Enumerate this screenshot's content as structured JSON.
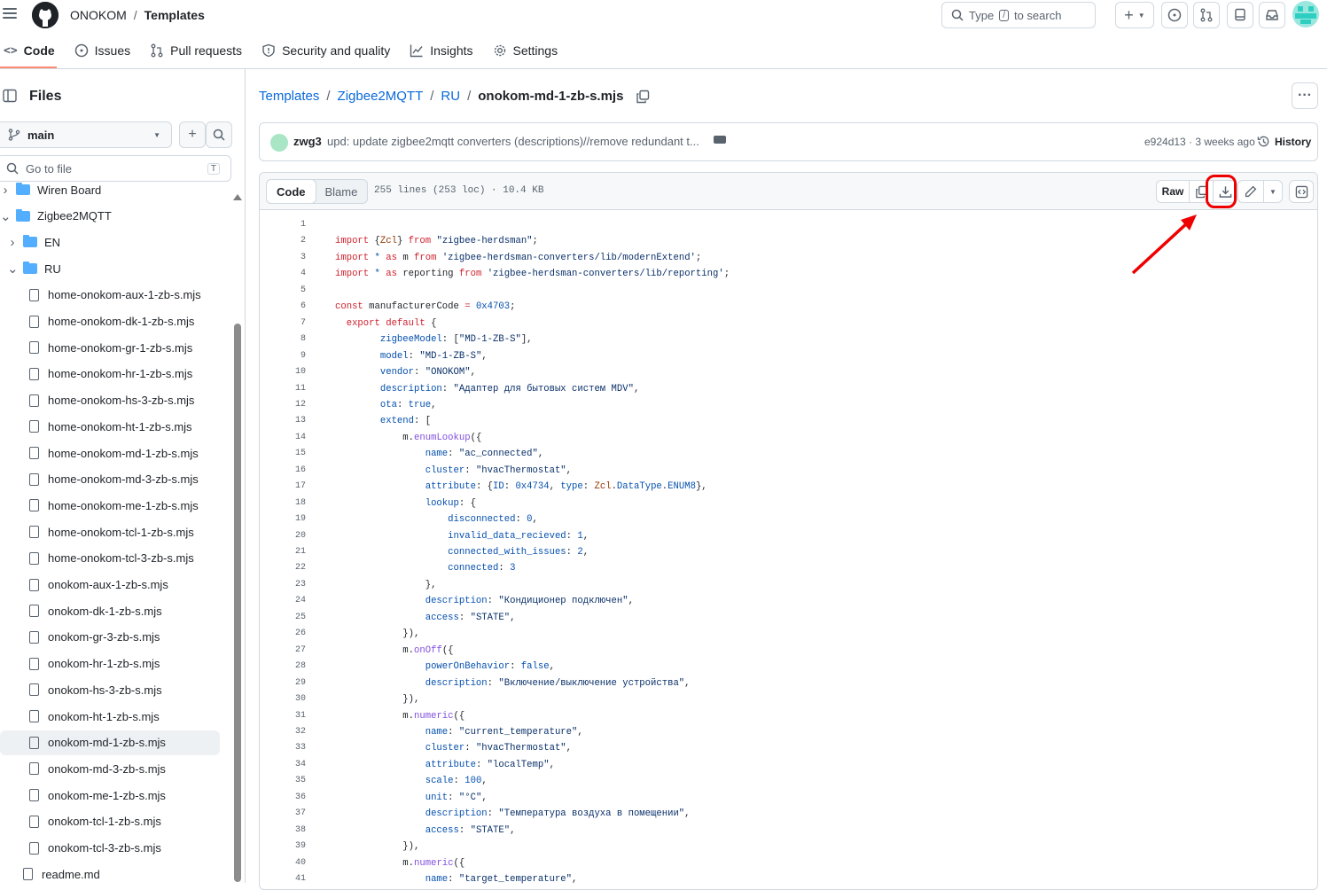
{
  "topbar": {
    "owner": "ONOKOM",
    "separator": "/",
    "repo": "Templates",
    "search_prefix": "Type",
    "search_key": "/",
    "search_suffix": "to search"
  },
  "repo_nav": {
    "tabs": [
      {
        "label": "Code"
      },
      {
        "label": "Issues"
      },
      {
        "label": "Pull requests"
      },
      {
        "label": "Security and quality"
      },
      {
        "label": "Insights"
      },
      {
        "label": "Settings"
      }
    ]
  },
  "sidebar": {
    "title": "Files",
    "branch": "main",
    "goto_placeholder": "Go to file",
    "goto_key": "T",
    "tree": [
      {
        "label": "Wiren Board",
        "type": "folder",
        "expanded": false,
        "depth": 0
      },
      {
        "label": "Zigbee2MQTT",
        "type": "folder",
        "expanded": true,
        "depth": 0
      },
      {
        "label": "EN",
        "type": "folder",
        "expanded": false,
        "depth": 1
      },
      {
        "label": "RU",
        "type": "folder",
        "expanded": true,
        "depth": 1
      },
      {
        "label": "home-onokom-aux-1-zb-s.mjs",
        "type": "file",
        "depth": 2
      },
      {
        "label": "home-onokom-dk-1-zb-s.mjs",
        "type": "file",
        "depth": 2
      },
      {
        "label": "home-onokom-gr-1-zb-s.mjs",
        "type": "file",
        "depth": 2
      },
      {
        "label": "home-onokom-hr-1-zb-s.mjs",
        "type": "file",
        "depth": 2
      },
      {
        "label": "home-onokom-hs-3-zb-s.mjs",
        "type": "file",
        "depth": 2
      },
      {
        "label": "home-onokom-ht-1-zb-s.mjs",
        "type": "file",
        "depth": 2
      },
      {
        "label": "home-onokom-md-1-zb-s.mjs",
        "type": "file",
        "depth": 2
      },
      {
        "label": "home-onokom-md-3-zb-s.mjs",
        "type": "file",
        "depth": 2
      },
      {
        "label": "home-onokom-me-1-zb-s.mjs",
        "type": "file",
        "depth": 2
      },
      {
        "label": "home-onokom-tcl-1-zb-s.mjs",
        "type": "file",
        "depth": 2
      },
      {
        "label": "home-onokom-tcl-3-zb-s.mjs",
        "type": "file",
        "depth": 2
      },
      {
        "label": "onokom-aux-1-zb-s.mjs",
        "type": "file",
        "depth": 2
      },
      {
        "label": "onokom-dk-1-zb-s.mjs",
        "type": "file",
        "depth": 2
      },
      {
        "label": "onokom-gr-3-zb-s.mjs",
        "type": "file",
        "depth": 2
      },
      {
        "label": "onokom-hr-1-zb-s.mjs",
        "type": "file",
        "depth": 2
      },
      {
        "label": "onokom-hs-3-zb-s.mjs",
        "type": "file",
        "depth": 2
      },
      {
        "label": "onokom-ht-1-zb-s.mjs",
        "type": "file",
        "depth": 2
      },
      {
        "label": "onokom-md-1-zb-s.mjs",
        "type": "file",
        "depth": 2,
        "selected": true
      },
      {
        "label": "onokom-md-3-zb-s.mjs",
        "type": "file",
        "depth": 2
      },
      {
        "label": "onokom-me-1-zb-s.mjs",
        "type": "file",
        "depth": 2
      },
      {
        "label": "onokom-tcl-1-zb-s.mjs",
        "type": "file",
        "depth": 2
      },
      {
        "label": "onokom-tcl-3-zb-s.mjs",
        "type": "file",
        "depth": 2
      },
      {
        "label": "readme.md",
        "type": "file",
        "depth": 1
      }
    ]
  },
  "breadcrumb": {
    "parts": [
      "Templates",
      "Zigbee2MQTT",
      "RU"
    ],
    "current": "onokom-md-1-zb-s.mjs",
    "separator": "/"
  },
  "commit": {
    "author": "zwg3",
    "message": "upd: update zigbee2mqtt converters (descriptions)//remove redundant t...",
    "meta": "e924d13 · 3 weeks ago",
    "history_label": "History"
  },
  "file_header": {
    "code_tab": "Code",
    "blame_tab": "Blame",
    "meta": "255 lines (253 loc) · 10.4 KB",
    "raw_label": "Raw"
  },
  "code_lines": [
    [],
    [
      [
        "k",
        "import "
      ],
      [
        "",
        "{"
      ],
      [
        "c",
        "Zcl"
      ],
      [
        "",
        "} "
      ],
      [
        "k",
        "from "
      ],
      [
        "s",
        "\"zigbee-herdsman\""
      ],
      [
        "",
        ";"
      ]
    ],
    [
      [
        "k",
        "import "
      ],
      [
        "p",
        "* "
      ],
      [
        "k",
        "as "
      ],
      [
        "",
        "m "
      ],
      [
        "k",
        "from "
      ],
      [
        "s",
        "'zigbee-herdsman-converters/lib/modernExtend'"
      ],
      [
        "",
        ";"
      ]
    ],
    [
      [
        "k",
        "import "
      ],
      [
        "p",
        "* "
      ],
      [
        "k",
        "as "
      ],
      [
        "",
        "reporting "
      ],
      [
        "k",
        "from "
      ],
      [
        "s",
        "'zigbee-herdsman-converters/lib/reporting'"
      ],
      [
        "",
        ";"
      ]
    ],
    [],
    [
      [
        "k",
        "const "
      ],
      [
        "",
        "manufacturerCode "
      ],
      [
        "k",
        "= "
      ],
      [
        "p",
        "0x4703"
      ],
      [
        "",
        ";"
      ]
    ],
    [
      [
        "",
        "  "
      ],
      [
        "k",
        "export default "
      ],
      [
        "",
        "{"
      ]
    ],
    [
      [
        "",
        "        "
      ],
      [
        "p",
        "zigbeeModel"
      ],
      [
        "",
        ": ["
      ],
      [
        "s",
        "\"MD-1-ZB-S\""
      ],
      [
        "",
        "],"
      ]
    ],
    [
      [
        "",
        "        "
      ],
      [
        "p",
        "model"
      ],
      [
        "",
        ": "
      ],
      [
        "s",
        "\"MD-1-ZB-S\""
      ],
      [
        "",
        ","
      ]
    ],
    [
      [
        "",
        "        "
      ],
      [
        "p",
        "vendor"
      ],
      [
        "",
        ": "
      ],
      [
        "s",
        "\"ONOKOM\""
      ],
      [
        "",
        ","
      ]
    ],
    [
      [
        "",
        "        "
      ],
      [
        "p",
        "description"
      ],
      [
        "",
        ": "
      ],
      [
        "s",
        "\"Адаптер для бытовых систем MDV\""
      ],
      [
        "",
        ","
      ]
    ],
    [
      [
        "",
        "        "
      ],
      [
        "p",
        "ota"
      ],
      [
        "",
        ": "
      ],
      [
        "p",
        "true"
      ],
      [
        "",
        ","
      ]
    ],
    [
      [
        "",
        "        "
      ],
      [
        "p",
        "extend"
      ],
      [
        "",
        ": ["
      ]
    ],
    [
      [
        "",
        "            m."
      ],
      [
        "f",
        "enumLookup"
      ],
      [
        "",
        "({"
      ]
    ],
    [
      [
        "",
        "                "
      ],
      [
        "p",
        "name"
      ],
      [
        "",
        ": "
      ],
      [
        "s",
        "\"ac_connected\""
      ],
      [
        "",
        ","
      ]
    ],
    [
      [
        "",
        "                "
      ],
      [
        "p",
        "cluster"
      ],
      [
        "",
        ": "
      ],
      [
        "s",
        "\"hvacThermostat\""
      ],
      [
        "",
        ","
      ]
    ],
    [
      [
        "",
        "                "
      ],
      [
        "p",
        "attribute"
      ],
      [
        "",
        ": {"
      ],
      [
        "p",
        "ID"
      ],
      [
        "",
        ": "
      ],
      [
        "p",
        "0x4734"
      ],
      [
        "",
        ", "
      ],
      [
        "p",
        "type"
      ],
      [
        "",
        ": "
      ],
      [
        "c",
        "Zcl"
      ],
      [
        "",
        "."
      ],
      [
        "p",
        "DataType"
      ],
      [
        "",
        "."
      ],
      [
        "p",
        "ENUM8"
      ],
      [
        "",
        "},"
      ]
    ],
    [
      [
        "",
        "                "
      ],
      [
        "p",
        "lookup"
      ],
      [
        "",
        ": {"
      ]
    ],
    [
      [
        "",
        "                    "
      ],
      [
        "p",
        "disconnected"
      ],
      [
        "",
        ": "
      ],
      [
        "p",
        "0"
      ],
      [
        "",
        ","
      ]
    ],
    [
      [
        "",
        "                    "
      ],
      [
        "p",
        "invalid_data_recieved"
      ],
      [
        "",
        ": "
      ],
      [
        "p",
        "1"
      ],
      [
        "",
        ","
      ]
    ],
    [
      [
        "",
        "                    "
      ],
      [
        "p",
        "connected_with_issues"
      ],
      [
        "",
        ": "
      ],
      [
        "p",
        "2"
      ],
      [
        "",
        ","
      ]
    ],
    [
      [
        "",
        "                    "
      ],
      [
        "p",
        "connected"
      ],
      [
        "",
        ": "
      ],
      [
        "p",
        "3"
      ]
    ],
    [
      [
        "",
        "                },"
      ]
    ],
    [
      [
        "",
        "                "
      ],
      [
        "p",
        "description"
      ],
      [
        "",
        ": "
      ],
      [
        "s",
        "\"Кондиционер подключен\""
      ],
      [
        "",
        ","
      ]
    ],
    [
      [
        "",
        "                "
      ],
      [
        "p",
        "access"
      ],
      [
        "",
        ": "
      ],
      [
        "s",
        "\"STATE\""
      ],
      [
        "",
        ","
      ]
    ],
    [
      [
        "",
        "            }),"
      ]
    ],
    [
      [
        "",
        "            m."
      ],
      [
        "f",
        "onOff"
      ],
      [
        "",
        "({"
      ]
    ],
    [
      [
        "",
        "                "
      ],
      [
        "p",
        "powerOnBehavior"
      ],
      [
        "",
        ": "
      ],
      [
        "p",
        "false"
      ],
      [
        "",
        ","
      ]
    ],
    [
      [
        "",
        "                "
      ],
      [
        "p",
        "description"
      ],
      [
        "",
        ": "
      ],
      [
        "s",
        "\"Включение/выключение устройства\""
      ],
      [
        "",
        ","
      ]
    ],
    [
      [
        "",
        "            }),"
      ]
    ],
    [
      [
        "",
        "            m."
      ],
      [
        "f",
        "numeric"
      ],
      [
        "",
        "({"
      ]
    ],
    [
      [
        "",
        "                "
      ],
      [
        "p",
        "name"
      ],
      [
        "",
        ": "
      ],
      [
        "s",
        "\"current_temperature\""
      ],
      [
        "",
        ","
      ]
    ],
    [
      [
        "",
        "                "
      ],
      [
        "p",
        "cluster"
      ],
      [
        "",
        ": "
      ],
      [
        "s",
        "\"hvacThermostat\""
      ],
      [
        "",
        ","
      ]
    ],
    [
      [
        "",
        "                "
      ],
      [
        "p",
        "attribute"
      ],
      [
        "",
        ": "
      ],
      [
        "s",
        "\"localTemp\""
      ],
      [
        "",
        ","
      ]
    ],
    [
      [
        "",
        "                "
      ],
      [
        "p",
        "scale"
      ],
      [
        "",
        ": "
      ],
      [
        "p",
        "100"
      ],
      [
        "",
        ","
      ]
    ],
    [
      [
        "",
        "                "
      ],
      [
        "p",
        "unit"
      ],
      [
        "",
        ": "
      ],
      [
        "s",
        "\"°C\""
      ],
      [
        "",
        ","
      ]
    ],
    [
      [
        "",
        "                "
      ],
      [
        "p",
        "description"
      ],
      [
        "",
        ": "
      ],
      [
        "s",
        "\"Температура воздуха в помещении\""
      ],
      [
        "",
        ","
      ]
    ],
    [
      [
        "",
        "                "
      ],
      [
        "p",
        "access"
      ],
      [
        "",
        ": "
      ],
      [
        "s",
        "\"STATE\""
      ],
      [
        "",
        ","
      ]
    ],
    [
      [
        "",
        "            }),"
      ]
    ],
    [
      [
        "",
        "            m."
      ],
      [
        "f",
        "numeric"
      ],
      [
        "",
        "({"
      ]
    ],
    [
      [
        "",
        "                "
      ],
      [
        "p",
        "name"
      ],
      [
        "",
        ": "
      ],
      [
        "s",
        "\"target_temperature\""
      ],
      [
        "",
        ","
      ]
    ]
  ]
}
